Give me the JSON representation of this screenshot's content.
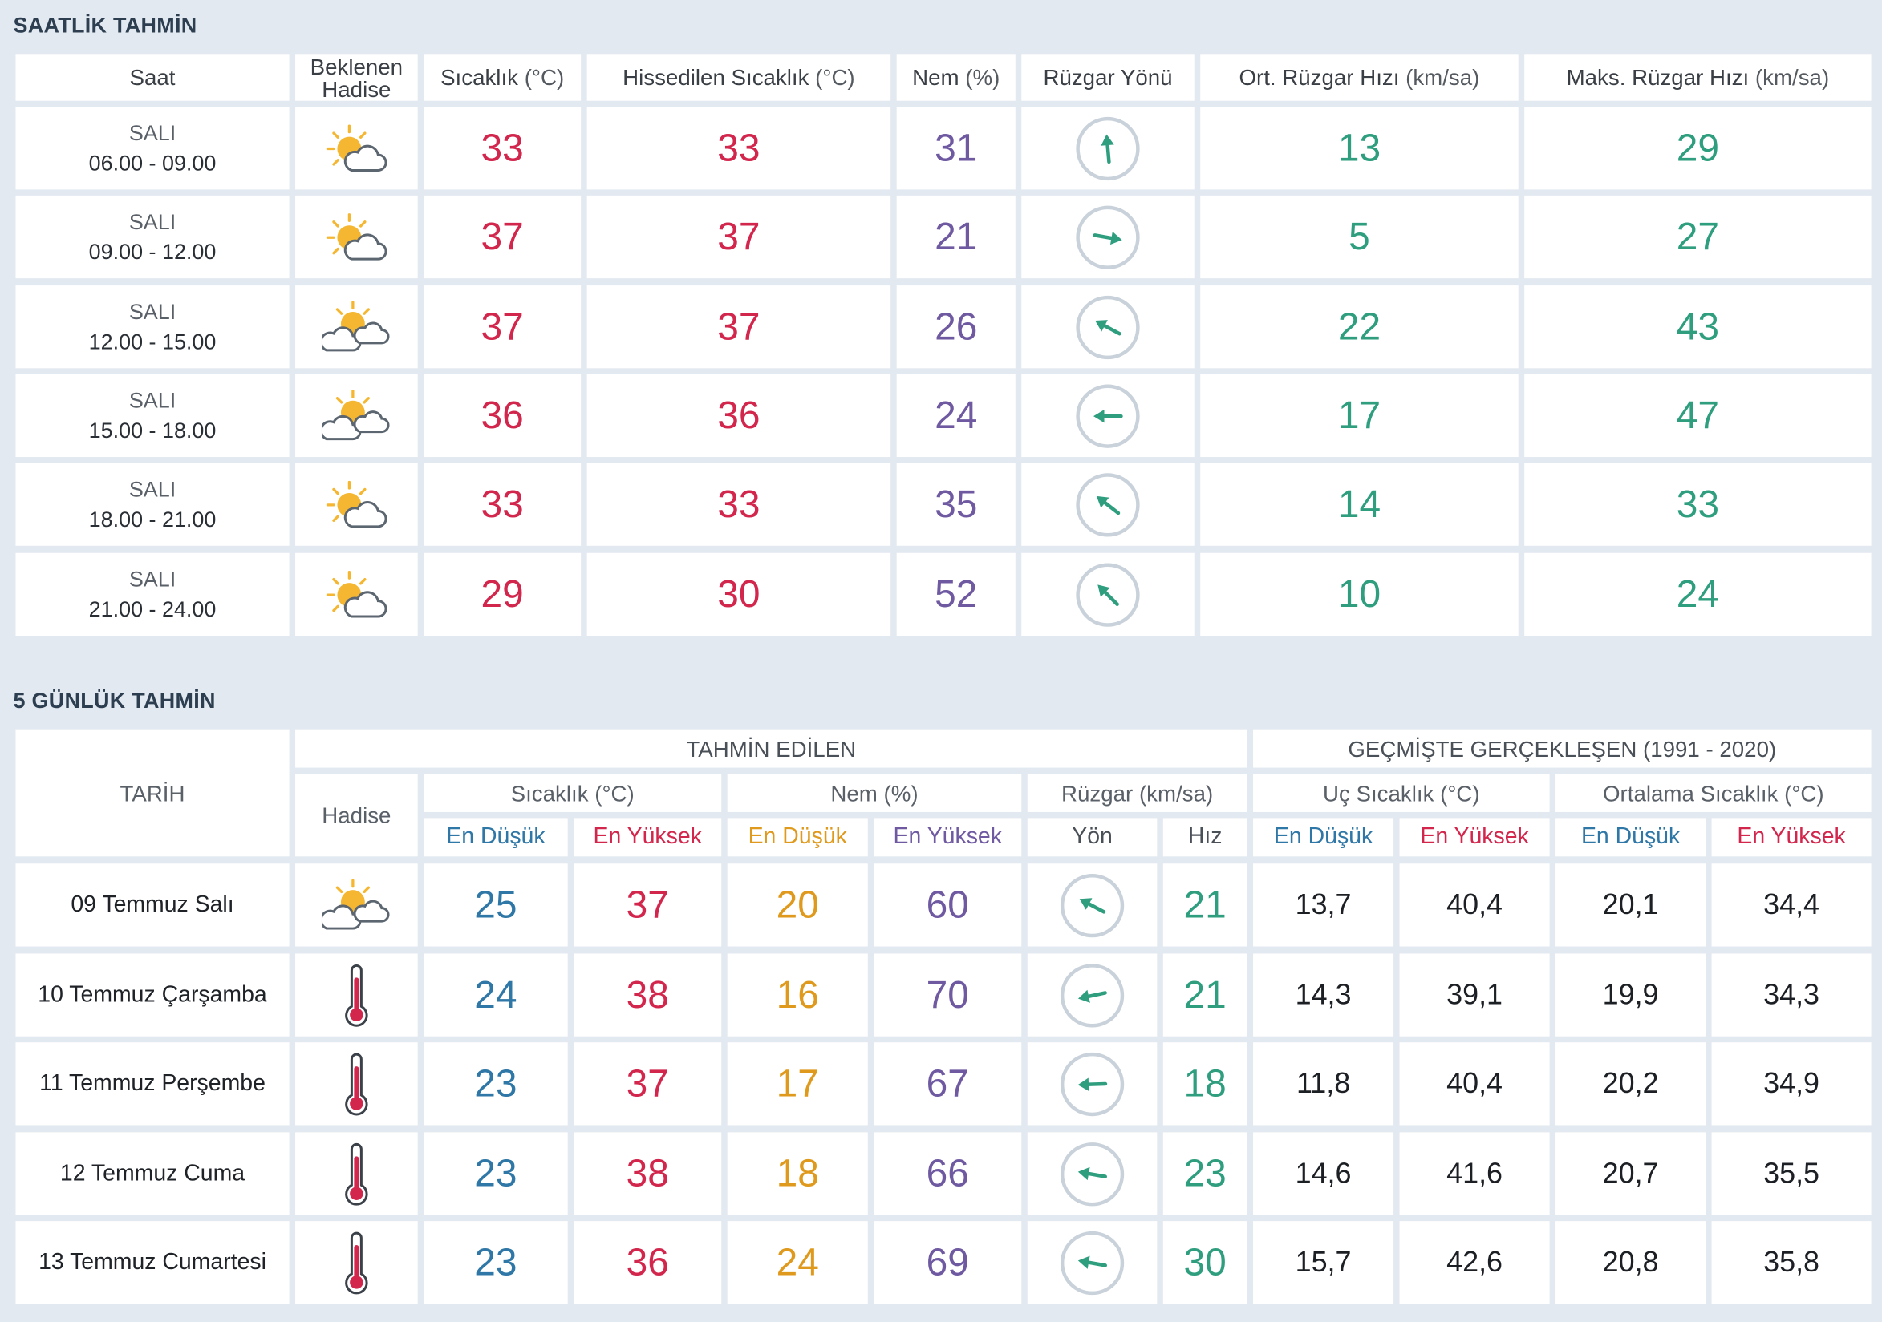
{
  "hourly": {
    "title": "SAATLİK TAHMİN",
    "headers": {
      "time": "Saat",
      "event": "Beklenen Hadise",
      "temp": "Sıcaklık",
      "temp_unit": "(°C)",
      "feels": "Hissedilen Sıcaklık",
      "feels_unit": "(°C)",
      "humidity": "Nem",
      "humidity_unit": "(%)",
      "wind_dir": "Rüzgar Yönü",
      "avg_wind": "Ort. Rüzgar Hızı",
      "avg_wind_unit": "(km/sa)",
      "max_wind": "Maks. Rüzgar Hızı",
      "max_wind_unit": "(km/sa)"
    },
    "rows": [
      {
        "day": "SALI",
        "time": "06.00 - 09.00",
        "icon": "partly-cloudy-icon",
        "temp": "33",
        "feels": "33",
        "humidity": "31",
        "wind_dir_deg": 175,
        "avg_wind": "13",
        "max_wind": "29"
      },
      {
        "day": "SALI",
        "time": "09.00 - 12.00",
        "icon": "partly-cloudy-icon",
        "temp": "37",
        "feels": "37",
        "humidity": "21",
        "wind_dir_deg": 280,
        "avg_wind": "5",
        "max_wind": "27"
      },
      {
        "day": "SALI",
        "time": "12.00 - 15.00",
        "icon": "partly-cloudy-icon",
        "temp": "37",
        "feels": "37",
        "humidity": "26",
        "wind_dir_deg": 118,
        "avg_wind": "22",
        "max_wind": "43"
      },
      {
        "day": "SALI",
        "time": "15.00 - 18.00",
        "icon": "partly-cloudy-icon",
        "temp": "36",
        "feels": "36",
        "humidity": "24",
        "wind_dir_deg": 90,
        "avg_wind": "17",
        "max_wind": "47"
      },
      {
        "day": "SALI",
        "time": "18.00 - 21.00",
        "icon": "partly-cloudy-icon",
        "temp": "33",
        "feels": "33",
        "humidity": "35",
        "wind_dir_deg": 128,
        "avg_wind": "14",
        "max_wind": "33"
      },
      {
        "day": "SALI",
        "time": "21.00 - 24.00",
        "icon": "partly-cloudy-icon",
        "temp": "29",
        "feels": "30",
        "humidity": "52",
        "wind_dir_deg": 135,
        "avg_wind": "10",
        "max_wind": "24"
      }
    ]
  },
  "daily": {
    "title": "5 GÜNLÜK TAHMİN",
    "headers": {
      "date": "TARİH",
      "forecast": "TAHMİN EDİLEN",
      "past": "GEÇMİŞTE GERÇEKLEŞEN (1991 - 2020)",
      "event": "Hadise",
      "temp": "Sıcaklık (°C)",
      "humidity": "Nem (%)",
      "wind": "Rüzgar (km/sa)",
      "extreme_temp": "Uç Sıcaklık (°C)",
      "avg_temp": "Ortalama Sıcaklık (°C)",
      "min": "En Düşük",
      "max": "En Yüksek",
      "dir": "Yön",
      "speed": "Hız"
    },
    "colors": {
      "low": "#2f77a6",
      "high": "#d2264d",
      "hum_low": "#df9a1d",
      "hum_high": "#6f5aa2"
    },
    "rows": [
      {
        "date": "09 Temmuz Salı",
        "icon": "partly-cloudy-icon",
        "tmin": "25",
        "tmax": "37",
        "hmin": "20",
        "hmax": "60",
        "wind_dir_deg": 118,
        "wind_speed": "21",
        "ext_min": "13,7",
        "ext_max": "40,4",
        "avg_min": "20,1",
        "avg_max": "34,4"
      },
      {
        "date": "10 Temmuz Çarşamba",
        "icon": "thermometer-icon",
        "tmin": "24",
        "tmax": "38",
        "hmin": "16",
        "hmax": "70",
        "wind_dir_deg": 78,
        "wind_speed": "21",
        "ext_min": "14,3",
        "ext_max": "39,1",
        "avg_min": "19,9",
        "avg_max": "34,3"
      },
      {
        "date": "11 Temmuz Perşembe",
        "icon": "thermometer-icon",
        "tmin": "23",
        "tmax": "37",
        "hmin": "17",
        "hmax": "67",
        "wind_dir_deg": 88,
        "wind_speed": "18",
        "ext_min": "11,8",
        "ext_max": "40,4",
        "avg_min": "20,2",
        "avg_max": "34,9"
      },
      {
        "date": "12 Temmuz Cuma",
        "icon": "thermometer-icon",
        "tmin": "23",
        "tmax": "38",
        "hmin": "18",
        "hmax": "66",
        "wind_dir_deg": 100,
        "wind_speed": "23",
        "ext_min": "14,6",
        "ext_max": "41,6",
        "avg_min": "20,7",
        "avg_max": "35,5"
      },
      {
        "date": "13 Temmuz Cumartesi",
        "icon": "thermometer-icon",
        "tmin": "23",
        "tmax": "36",
        "hmin": "24",
        "hmax": "69",
        "wind_dir_deg": 100,
        "wind_speed": "30",
        "ext_min": "15,7",
        "ext_max": "42,6",
        "avg_min": "20,8",
        "avg_max": "35,8"
      }
    ]
  }
}
